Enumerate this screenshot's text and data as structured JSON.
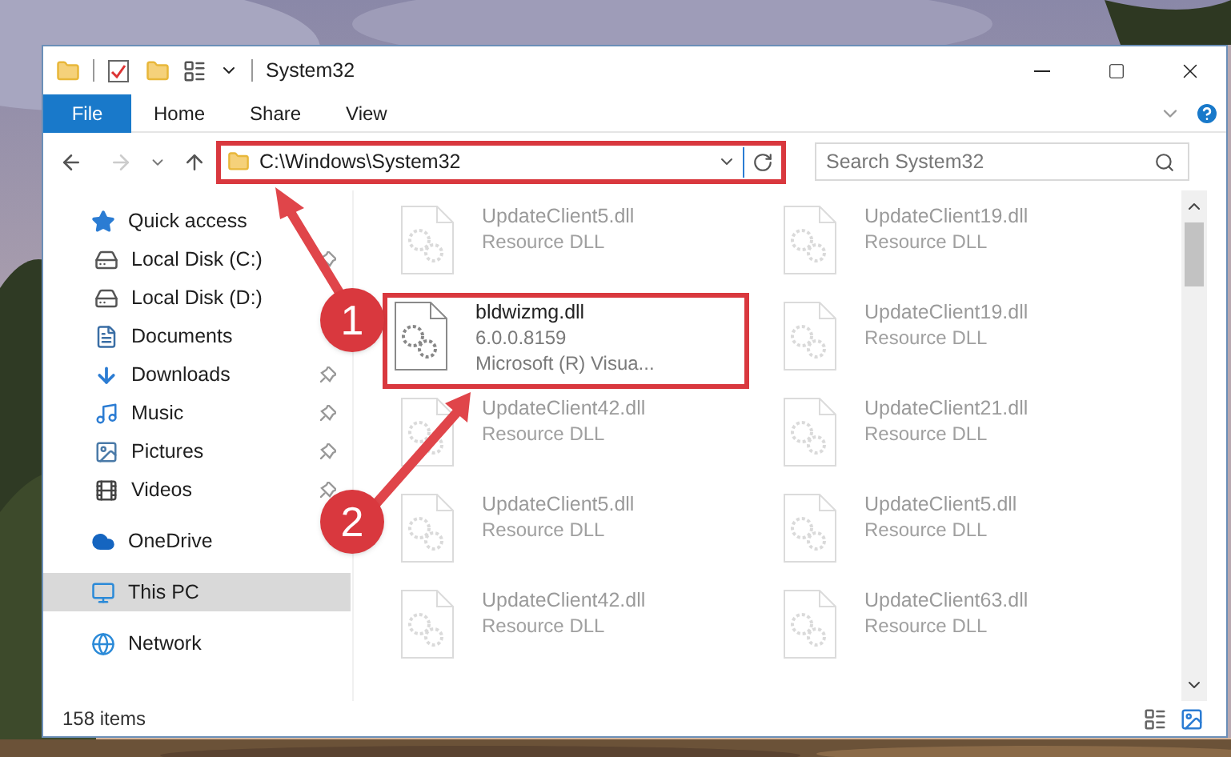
{
  "window": {
    "title": "System32"
  },
  "ribbon_tabs": [
    {
      "label": "File",
      "kind": "file"
    },
    {
      "label": "Home",
      "kind": "tab"
    },
    {
      "label": "Share",
      "kind": "tab"
    },
    {
      "label": "View",
      "kind": "tab"
    }
  ],
  "address": {
    "path": "C:\\Windows\\System32"
  },
  "search": {
    "placeholder": "Search System32"
  },
  "nav": [
    {
      "label": "Quick access",
      "kind": "star",
      "selected": false,
      "children": [
        {
          "label": "Local Disk (C:)",
          "kind": "disk",
          "pinned": true,
          "selected": false
        },
        {
          "label": "Local Disk (D:)",
          "kind": "disk",
          "pinned": false,
          "selected": false
        },
        {
          "label": "Documents",
          "kind": "document",
          "pinned": false,
          "selected": false
        },
        {
          "label": "Downloads",
          "kind": "download",
          "pinned": true,
          "selected": false
        },
        {
          "label": "Music",
          "kind": "music",
          "pinned": true,
          "selected": false
        },
        {
          "label": "Pictures",
          "kind": "pictures",
          "pinned": true,
          "selected": false
        },
        {
          "label": "Videos",
          "kind": "video",
          "pinned": true,
          "selected": false
        }
      ]
    },
    {
      "label": "OneDrive",
      "kind": "cloud",
      "selected": false
    },
    {
      "label": "This PC",
      "kind": "pc",
      "selected": true
    },
    {
      "label": "Network",
      "kind": "network",
      "selected": false
    }
  ],
  "files": [
    {
      "name": "UpdateClient5.dll",
      "details": [
        "Resource DLL"
      ],
      "kind": "faded"
    },
    {
      "name": "UpdateClient19.dll",
      "details": [
        "Resource DLL"
      ],
      "kind": "faded"
    },
    {
      "name": "bldwizmg.dll",
      "details": [
        "6.0.0.8159",
        "Microsoft (R) Visua..."
      ],
      "kind": "focus"
    },
    {
      "name": "UpdateClient19.dll",
      "details": [
        "Resource DLL"
      ],
      "kind": "faded"
    },
    {
      "name": "UpdateClient42.dll",
      "details": [
        "Resource DLL"
      ],
      "kind": "faded"
    },
    {
      "name": "UpdateClient21.dll",
      "details": [
        "Resource DLL"
      ],
      "kind": "faded"
    },
    {
      "name": "UpdateClient5.dll",
      "details": [
        "Resource DLL"
      ],
      "kind": "faded"
    },
    {
      "name": "UpdateClient5.dll",
      "details": [
        "Resource DLL"
      ],
      "kind": "faded"
    },
    {
      "name": "UpdateClient42.dll",
      "details": [
        "Resource DLL"
      ],
      "kind": "faded"
    },
    {
      "name": "UpdateClient63.dll",
      "details": [
        "Resource DLL"
      ],
      "kind": "faded"
    }
  ],
  "status_bar": {
    "count": "158 items"
  },
  "annotations": [
    {
      "number": "1"
    },
    {
      "number": "2"
    }
  ]
}
